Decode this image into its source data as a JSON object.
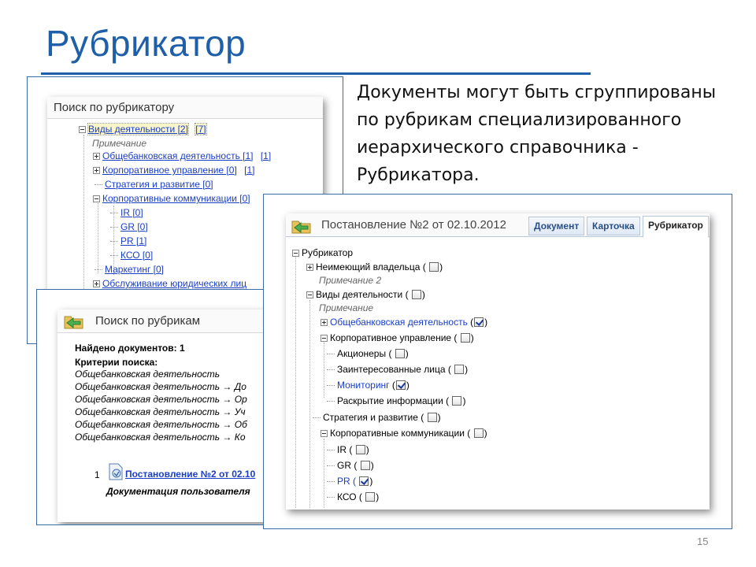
{
  "slide": {
    "title": "Рубрикатор",
    "description": "Документы могут быть сгруппированы\nпо рубрикам специализированного\nиерархического справочника -\nРубрикатора.",
    "page_number": "15"
  },
  "rubricator_search": {
    "header": "Поиск по рубрикатору",
    "root": {
      "label": "Виды деятельности [2]",
      "extra": "[7]"
    },
    "root_note": "Примечание",
    "items": [
      {
        "label": "Общебанковская деятельность [1]",
        "extra": "[1]"
      },
      {
        "label": "Корпоративное управление [0]",
        "extra": "[1]"
      },
      {
        "label": "Стратегия и развитие [0]"
      },
      {
        "label": "Корпоративные коммуникации [0]"
      },
      {
        "label": "IR [0]"
      },
      {
        "label": "GR [0]"
      },
      {
        "label": "PR [1]"
      },
      {
        "label": "КСО [0]"
      },
      {
        "label": "Маркетинг [0]"
      },
      {
        "label": "Обслуживание юридических лиц"
      }
    ]
  },
  "rubric_results": {
    "header": "Поиск по рубрикам",
    "found_label": "Найдено документов: 1",
    "criteria_label": "Критерии поиска:",
    "criteria": [
      "Общебанковская деятельность",
      "Общебанковская деятельность → До",
      "Общебанковская деятельность → Ор",
      "Общебанковская деятельность → Уч",
      "Общебанковская деятельность → Об",
      "Общебанковская деятельность → Ко"
    ],
    "result_index": "1",
    "result_link": "Постановление №2 от 02.10",
    "result_subtitle": "Документация пользователя"
  },
  "document_card": {
    "title": "Постановление №2 от 02.10.2012",
    "tabs": [
      "Документ",
      "Карточка",
      "Рубрикатор"
    ],
    "active_tab": "Рубрикатор",
    "tree": {
      "root": "Рубрикатор",
      "owner": "Неимеющий владельца (",
      "owner_note": "Примечание 2",
      "activities": "Виды деятельности (",
      "activities_note": "Примечание",
      "general": "Общебанковская деятельность",
      "corporate_gov": "Корпоративное управление (",
      "shareholders": "Акционеры (",
      "stakeholders": "Заинтересованные лица (",
      "monitoring": "Мониторинг",
      "disclosure": "Раскрытие информации (",
      "strategy": "Стратегия и развитие (",
      "communications": "Корпоративные коммуникации (",
      "ir": "IR (",
      "gr": "GR (",
      "pr": "PR (",
      "kso": "КСО (",
      "close": ")"
    }
  }
}
